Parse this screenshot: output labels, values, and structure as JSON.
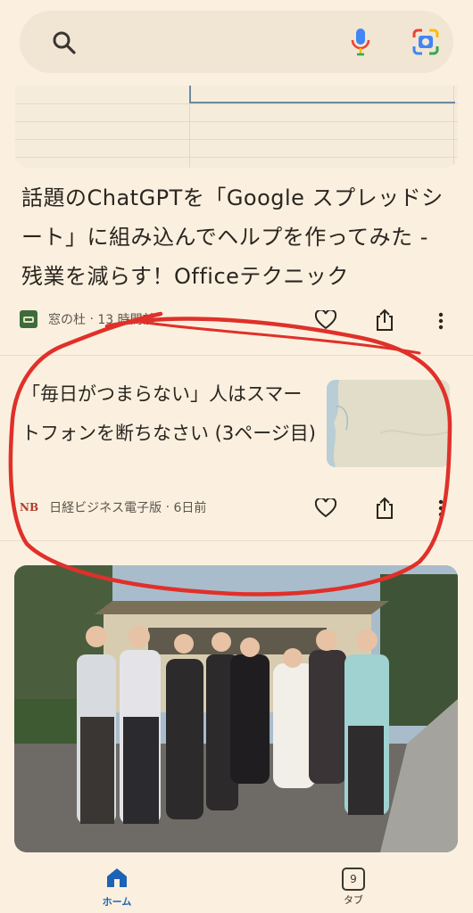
{
  "search": {
    "search_icon": "search-icon",
    "mic_icon": "mic-icon",
    "lens_icon": "lens-icon"
  },
  "card1": {
    "title": "話題のChatGPTを「Google スプレッドシート」に組み込んでヘルプを作ってみた - 残業を減らす！Officeテクニック",
    "source": "窓の杜",
    "time": "13 時間前"
  },
  "card2": {
    "title": "「毎日がつまらない」人はスマートフォンを断ちなさい (3ページ目)",
    "source_logo": "NB",
    "source": "日経ビジネス電子版",
    "time": "6日前"
  },
  "bottom_nav": {
    "home_label": "ホーム",
    "tabs_label": "タブ",
    "tab_count": "9"
  },
  "colors": {
    "background": "#fbf0df",
    "accent": "#1d63b5",
    "annotation": "#e0302a"
  }
}
